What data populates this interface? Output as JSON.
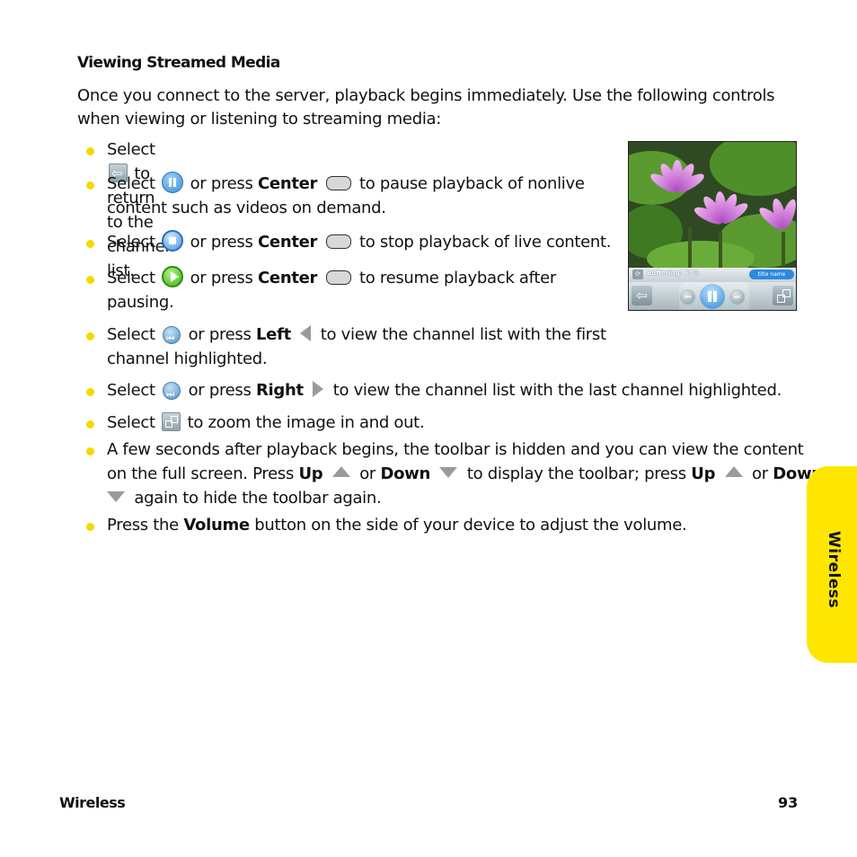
{
  "section": {
    "heading": "Viewing Streamed Media",
    "intro": "Once you connect to the server, playback begins immediately. Use the following controls when viewing or listening to streaming media:"
  },
  "bullets": [
    {
      "pre": "Select",
      "icon": "back-icon",
      "post": "to return to the channel list."
    },
    {
      "pre": "Select",
      "icon": "pause-icon",
      "mid": "or press",
      "key": "Center",
      "key_icon": "center-key-icon",
      "post": "to pause playback of nonlive",
      "cont": "content such as videos on demand."
    },
    {
      "pre": "Select",
      "icon": "stop-icon",
      "mid": "or press",
      "key": "Center",
      "key_icon": "center-key-icon",
      "post": "to stop playback of live content."
    },
    {
      "pre": "Select",
      "icon": "play-icon",
      "mid": "or press",
      "key": "Center",
      "key_icon": "center-key-icon",
      "post": "to resume playback after",
      "cont": "pausing."
    },
    {
      "pre": "Select",
      "icon": "previous-icon",
      "mid": "or press",
      "key": "Left",
      "key_icon": "left-arrow-icon",
      "post": "to view the channel list with the first",
      "cont": "channel highlighted."
    },
    {
      "pre": "Select",
      "icon": "next-icon",
      "mid": "or press",
      "key": "Right",
      "key_icon": "right-arrow-icon",
      "post": "to view the channel list with the last channel highlighted."
    },
    {
      "pre": "Select",
      "icon": "zoom-icon",
      "post": "to zoom the image in and out."
    },
    {
      "line1": "A few seconds after playback begins, the toolbar is hidden and you can view the content",
      "line2_a": "on the full screen. Press",
      "up": "Up",
      "or": "or",
      "down": "Down",
      "line2_b": "to display the toolbar; press",
      "up2": "Up",
      "or2": "or",
      "down2": "Down",
      "line3": "again to hide the toolbar again."
    },
    {
      "pre": "Press the",
      "key": "Volume",
      "post": "button on the side of your device to adjust the volume."
    }
  ],
  "screenshot": {
    "status": "Buffering: 60%",
    "title_pill": "title name",
    "icons": [
      "refresh-icon",
      "back-icon",
      "previous-icon",
      "pause-icon",
      "next-icon",
      "zoom-icon"
    ]
  },
  "side_tab": {
    "label": "Wireless",
    "color": "#ffe600"
  },
  "footer": {
    "section": "Wireless",
    "page": "93"
  },
  "colors": {
    "bullet": "#f5d800",
    "tab": "#ffe600"
  }
}
